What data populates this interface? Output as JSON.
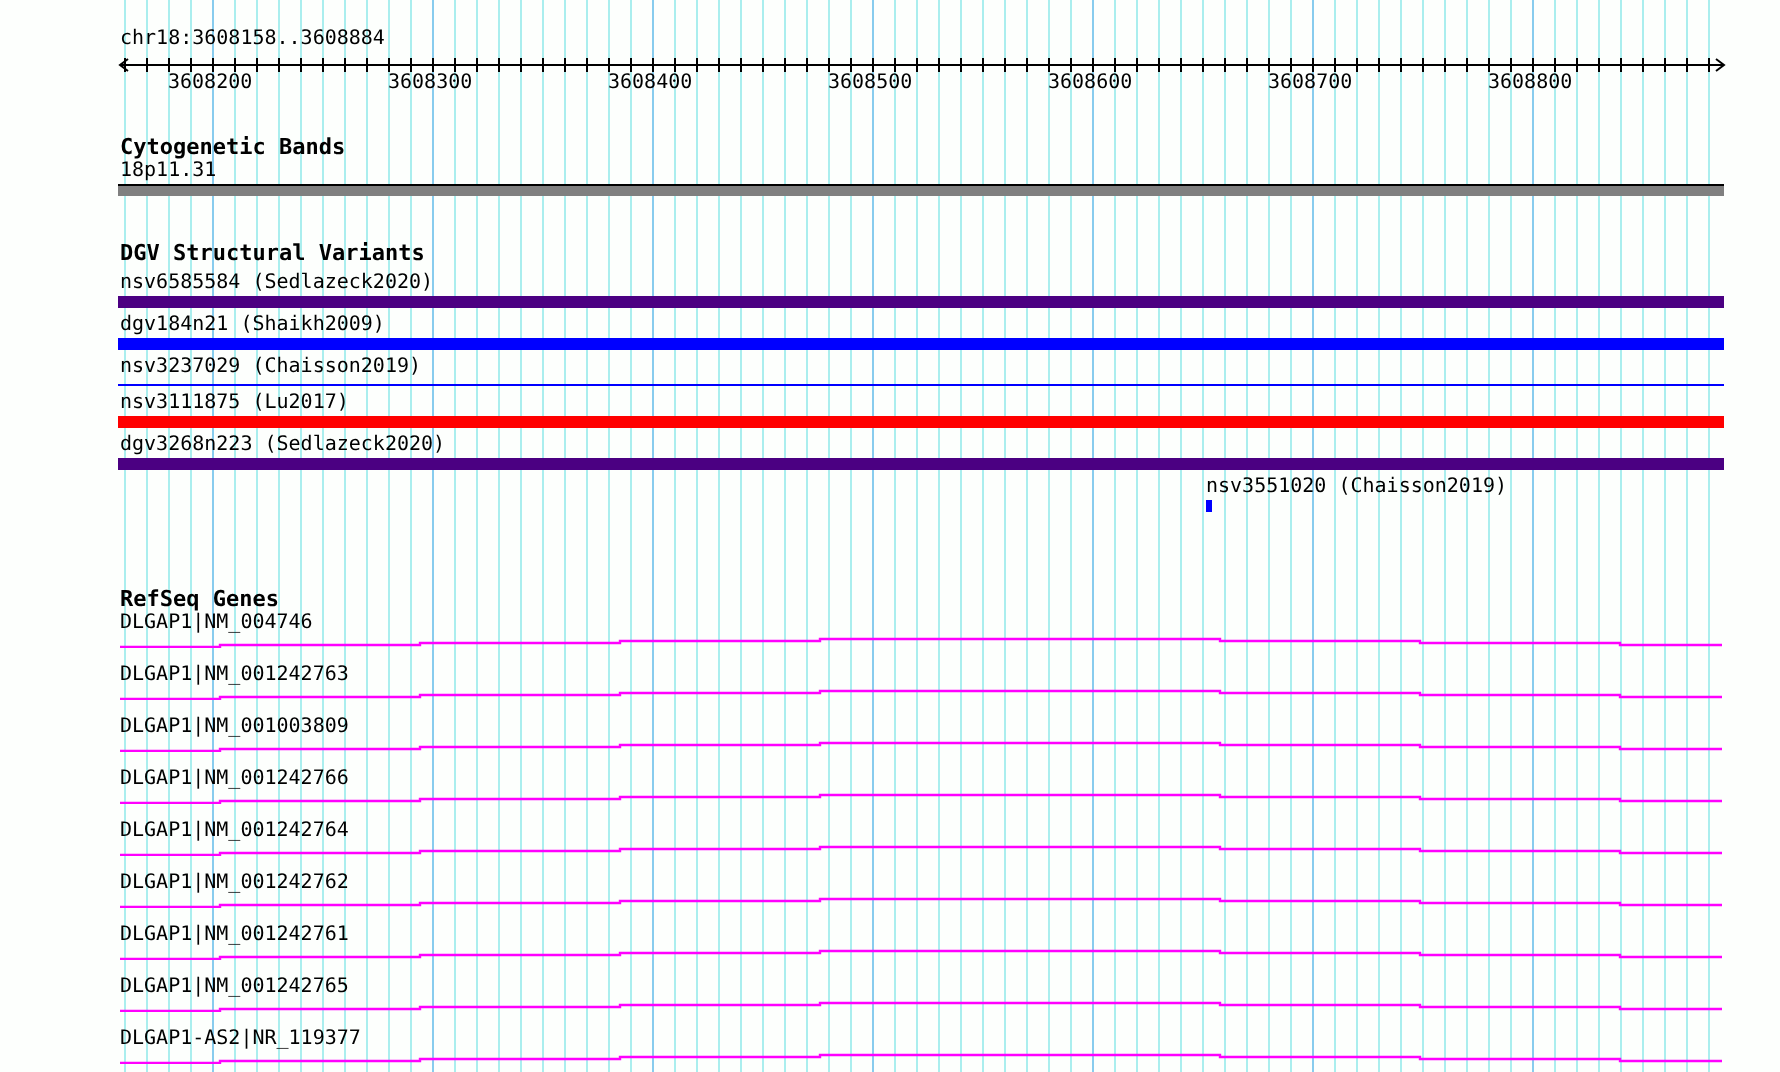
{
  "ruler": {
    "location": "chr18:3608158..3608884",
    "tick_labels": [
      "3608200",
      "3608300",
      "3608400",
      "3608500",
      "3608600",
      "3608700",
      "3608800"
    ]
  },
  "tracks": [
    {
      "kind": "cytoband",
      "title": "Cytogenetic Bands",
      "features": [
        {
          "label": "18p11.31",
          "kind": "thick",
          "color": "#808080"
        }
      ]
    },
    {
      "kind": "variants",
      "title": "DGV Structural Variants",
      "features": [
        {
          "label": "nsv6585584 (Sedlazeck2020)",
          "kind": "thick",
          "color": "#4b0082"
        },
        {
          "label": "dgv184n21 (Shaikh2009)",
          "kind": "thick",
          "color": "#0000ff"
        },
        {
          "label": "nsv3237029 (Chaisson2019)",
          "kind": "thin",
          "color": "#0000ff"
        },
        {
          "label": "nsv3111875 (Lu2017)",
          "kind": "thick",
          "color": "#ff0000"
        },
        {
          "label": "dgv3268n223 (Sedlazeck2020)",
          "kind": "thick",
          "color": "#4b0082"
        },
        {
          "label": "nsv3551020 (Chaisson2019)",
          "kind": "point",
          "color": "#0000ff"
        }
      ]
    },
    {
      "kind": "genes",
      "title": "RefSeq Genes",
      "features": [
        {
          "label": "DLGAP1|NM_004746"
        },
        {
          "label": "DLGAP1|NM_001242763"
        },
        {
          "label": "DLGAP1|NM_001003809"
        },
        {
          "label": "DLGAP1|NM_001242766"
        },
        {
          "label": "DLGAP1|NM_001242764"
        },
        {
          "label": "DLGAP1|NM_001242762"
        },
        {
          "label": "DLGAP1|NM_001242761"
        },
        {
          "label": "DLGAP1|NM_001242765"
        },
        {
          "label": "DLGAP1-AS2|NR_119377"
        }
      ]
    }
  ]
}
